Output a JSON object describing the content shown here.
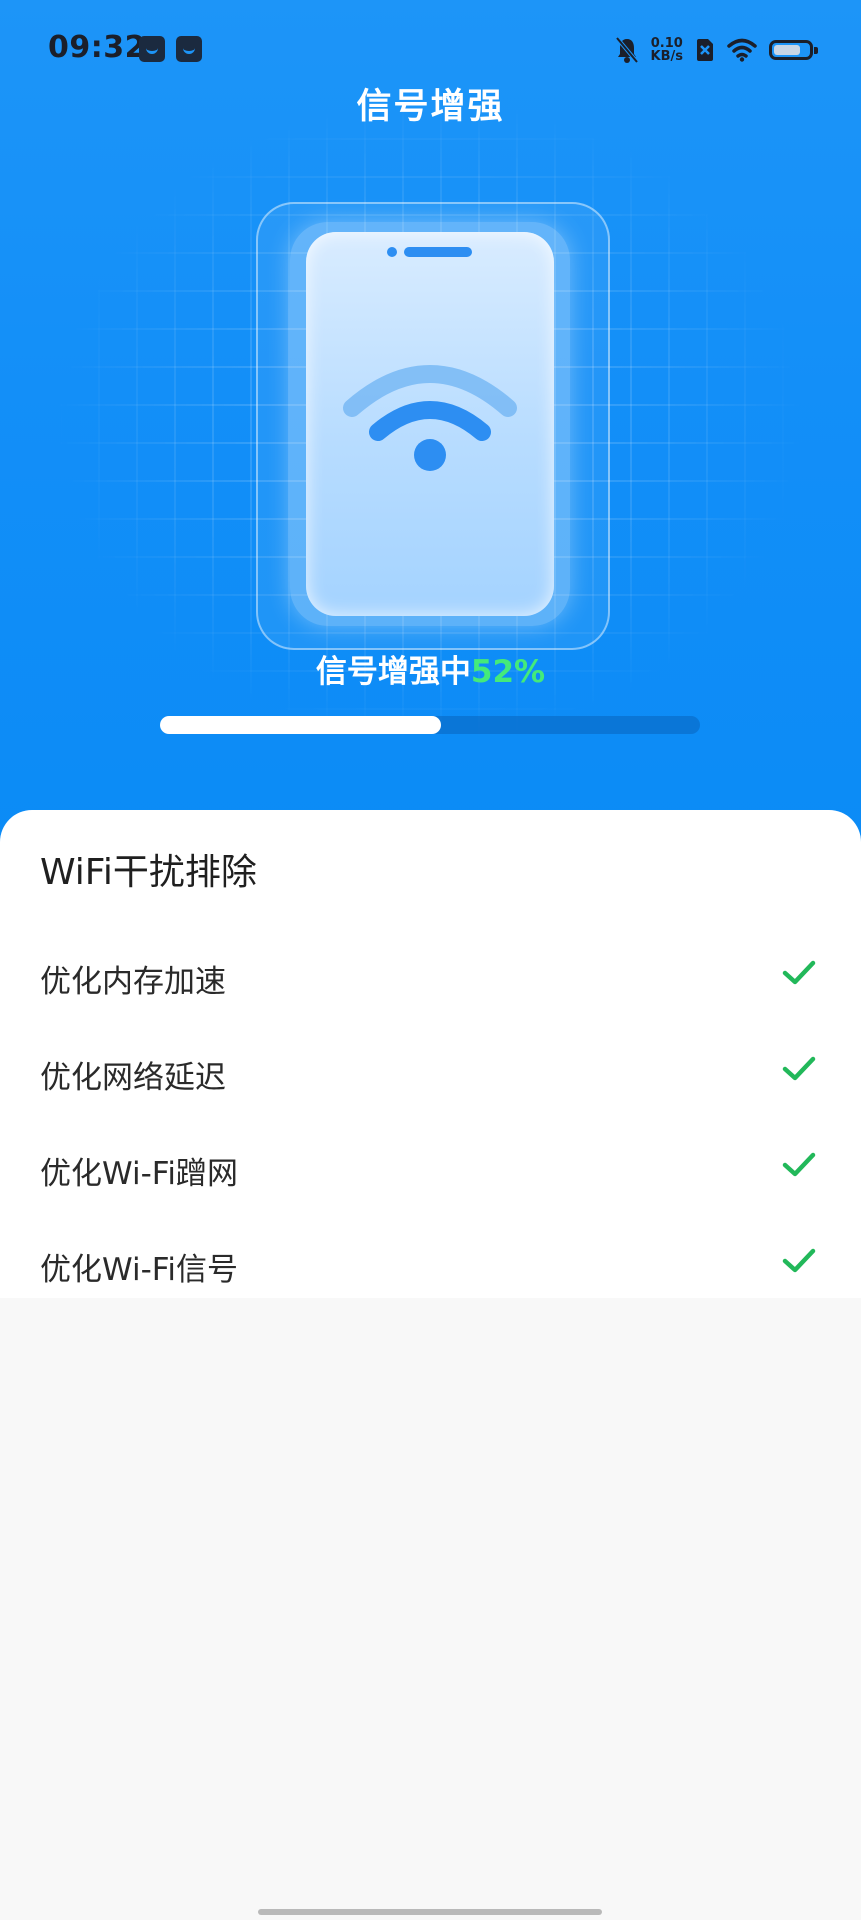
{
  "status_bar": {
    "time": "09:32",
    "net_speed_value": "0.10",
    "net_speed_unit": "KB/s",
    "icons": [
      "mail-icon",
      "calendar-icon",
      "mute-icon",
      "sim-icon",
      "wifi-icon",
      "battery-icon"
    ]
  },
  "header": {
    "title": "信号增强"
  },
  "boost": {
    "label": "信号增强中",
    "percent_text": "52%",
    "progress": 0.52,
    "accent_color": "#44ea7a"
  },
  "card": {
    "title": "WiFi干扰排除",
    "items": [
      {
        "label": "优化内存加速",
        "status": "done"
      },
      {
        "label": "优化网络延迟",
        "status": "done"
      },
      {
        "label": "优化Wi-Fi蹭网",
        "status": "done"
      },
      {
        "label": "优化Wi-Fi信号",
        "status": "done"
      }
    ],
    "check_color": "#22b85a"
  },
  "colors": {
    "hero_blue": "#138ff8",
    "background": "#f8f8f8"
  }
}
